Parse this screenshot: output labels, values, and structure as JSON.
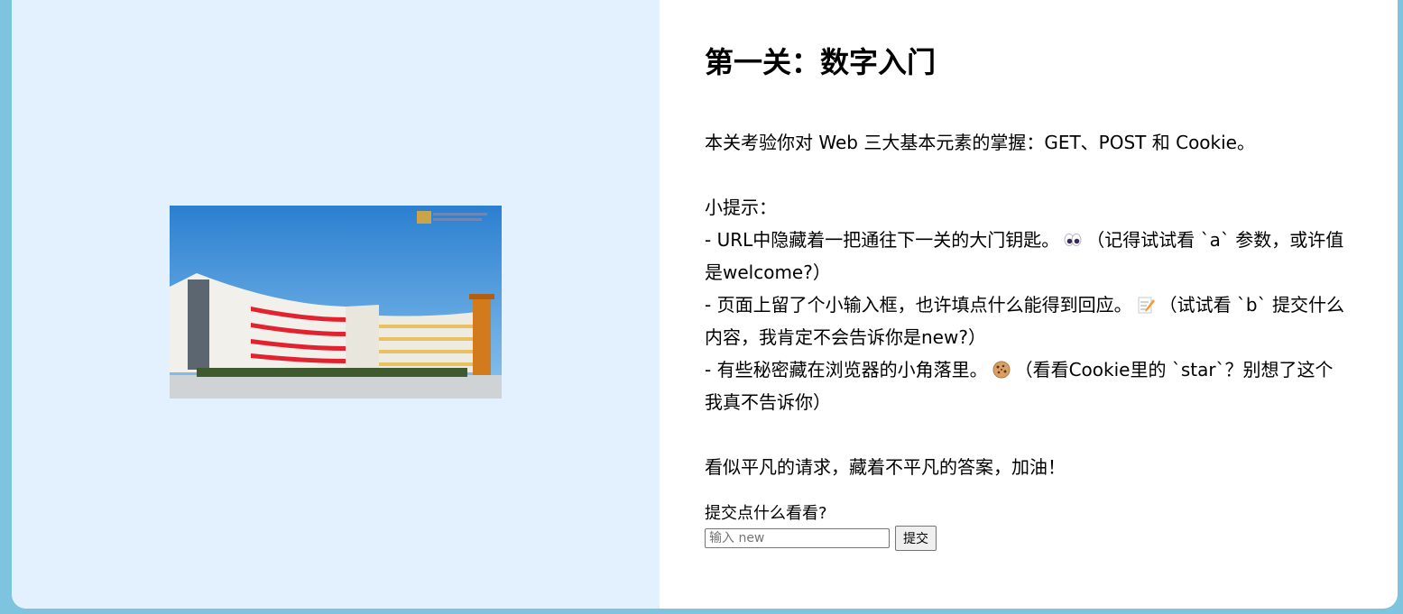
{
  "level": {
    "title": "第一关：数字入门"
  },
  "content": {
    "intro": "本关考验你对 Web 三大基本元素的掌握：GET、POST 和 Cookie。",
    "hint_heading": "小提示：",
    "hint1_a": "- URL中隐藏着一把通往下一关的大门钥匙。",
    "hint1_b": "（记得试试看 `a` 参数，或许值是welcome?）",
    "hint2_a": "- 页面上留了个小输入框，也许填点什么能得到回应。",
    "hint2_b": "（试试看 `b` 提交什么内容，我肯定不会告诉你是new?）",
    "hint3_a": "- 有些秘密藏在浏览器的小角落里。",
    "hint3_b": "（看看Cookie里的 `star`？别想了这个我真不告诉你）",
    "outro": "看似平凡的请求，藏着不平凡的答案，加油！"
  },
  "icons": {
    "hint1": "eyes-icon",
    "hint2": "memo-icon",
    "hint3": "cookie-icon"
  },
  "form": {
    "label": "提交点什么看看?",
    "placeholder": "输入 new",
    "value": "",
    "submit_label": "提交"
  },
  "colors": {
    "page_background": "#7ec4de",
    "left_pane": "#e3f1ff",
    "card": "#ffffff"
  }
}
